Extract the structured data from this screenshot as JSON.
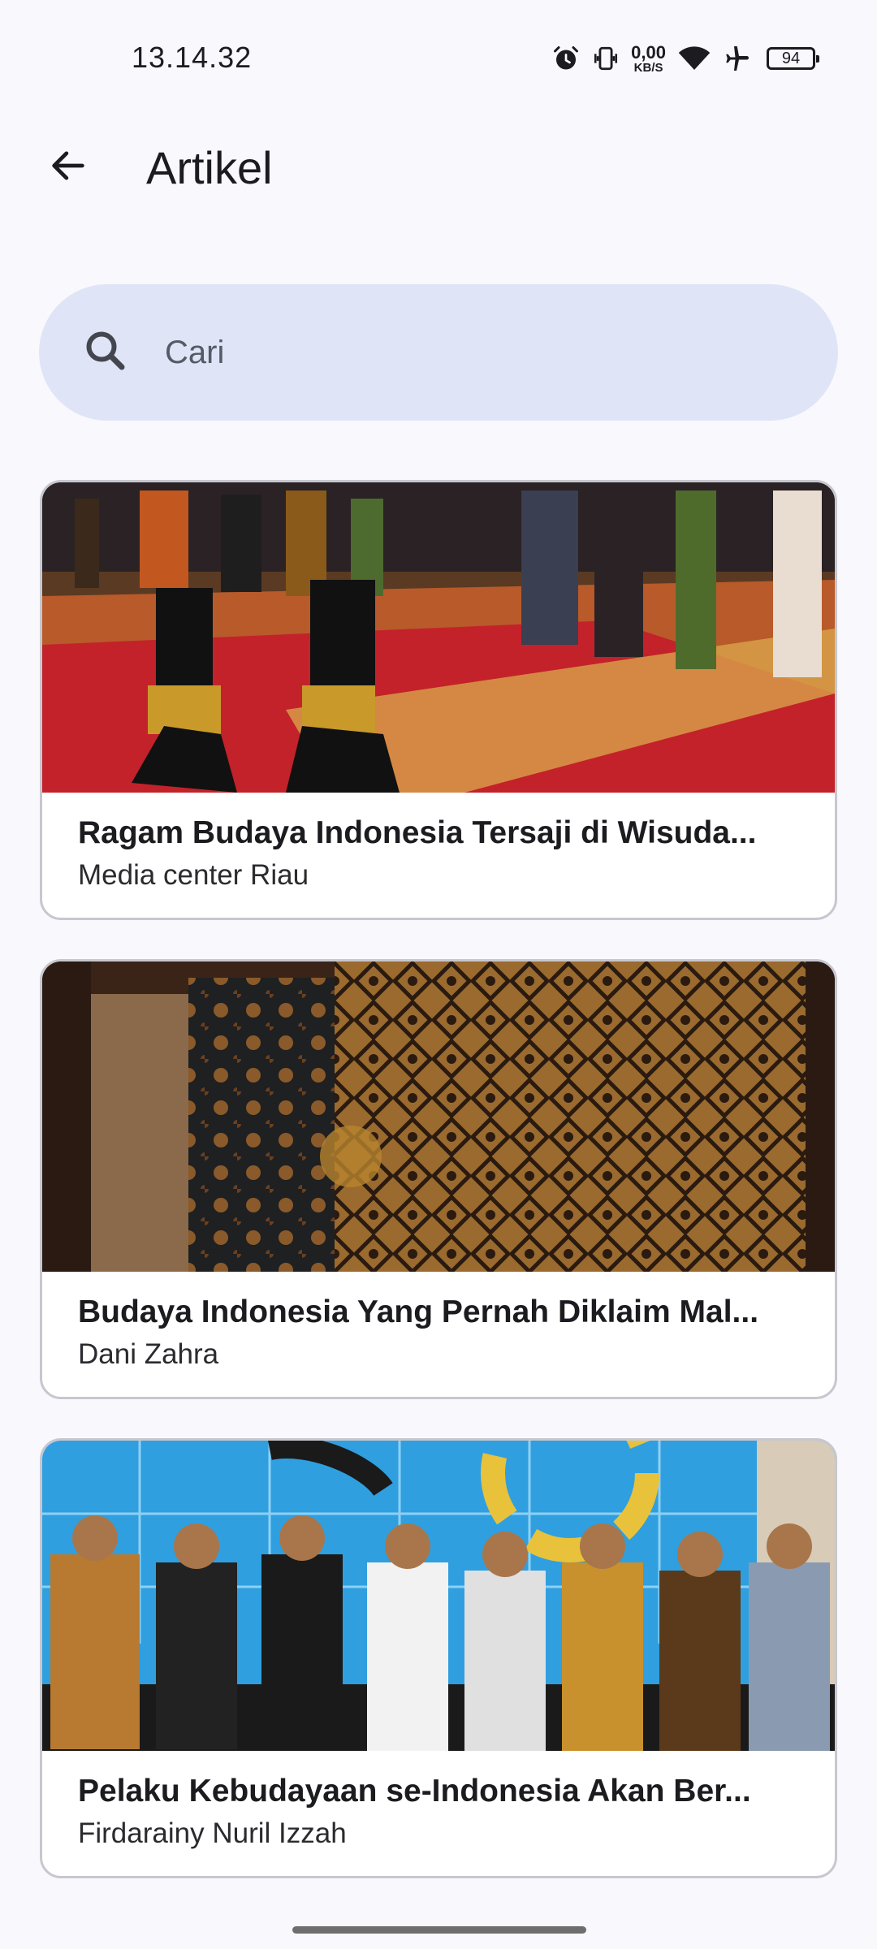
{
  "status_bar": {
    "time": "13.14.32",
    "net_speed_value": "0,00",
    "net_speed_unit": "KB/S",
    "battery": "94",
    "icons": [
      "alarm-icon",
      "vibrate-icon",
      "wifi-icon",
      "airplane-icon",
      "battery-icon"
    ]
  },
  "app_bar": {
    "back_icon": "arrow-back-icon",
    "title": "Artikel"
  },
  "search": {
    "placeholder": "Cari",
    "value": "",
    "icon": "search-icon"
  },
  "articles": [
    {
      "title": "Ragam Budaya Indonesia Tersaji di Wisuda...",
      "author": "Media center Riau"
    },
    {
      "title": "Budaya Indonesia Yang Pernah Diklaim Mal...",
      "author": "Dani Zahra"
    },
    {
      "title": "Pelaku Kebudayaan se-Indonesia Akan Ber...",
      "author": "Firdarainy Nuril Izzah"
    }
  ],
  "colors": {
    "background": "#f9f8fd",
    "search_bg": "#dfe5f7",
    "card_border": "#c7c7cf",
    "text": "#1c1b1f"
  }
}
